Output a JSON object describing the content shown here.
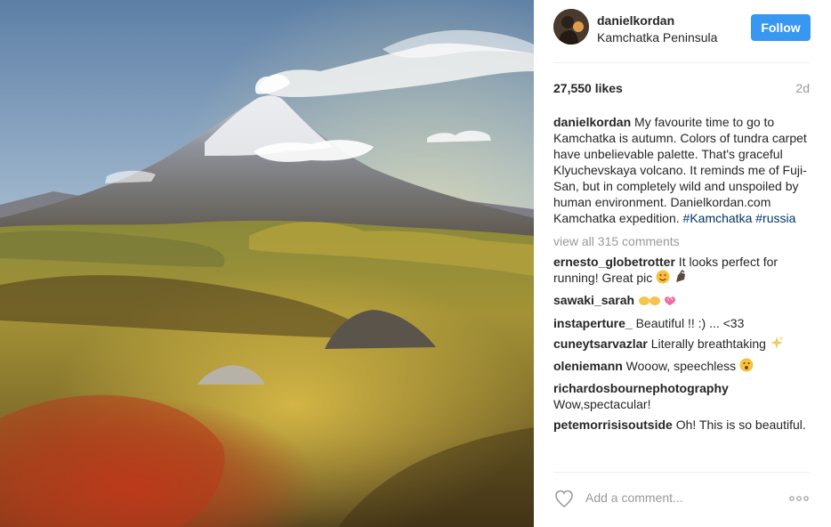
{
  "post": {
    "username": "danielkordan",
    "location": "Kamchatka Peninsula",
    "follow_label": "Follow",
    "likes": "27,550 likes",
    "time_ago": "2d",
    "caption_user": "danielkordan",
    "caption_text": " My favourite time to go to Kamchatka is autumn. Colors of tundra carpet have unbelievable palette. That's graceful Klyuchevskaya volcano. It reminds me of Fuji-San, but in completely wild and unspoiled by human environment. Danielkordan.com Kamchatka expedition. ",
    "hashtags": [
      "#Kamchatka",
      "#russia"
    ],
    "view_all": "view all 315 comments",
    "add_comment_placeholder": "Add a comment..."
  },
  "comments": [
    {
      "user": "ernesto_globetrotter",
      "text": " It looks perfect for running! Great pic ",
      "emoji": "heart-eyes-face-emoji"
    },
    {
      "user": "sawaki_sarah",
      "text": " ",
      "emoji": "clapping-hands-emoji"
    },
    {
      "user": "instaperture_",
      "text": " Beautiful !! :) ... <33",
      "emoji": ""
    },
    {
      "user": "cuneytsarvazlar",
      "text": " Literally breathtaking ",
      "emoji": "sparkles-emoji"
    },
    {
      "user": "oleniemann",
      "text": " Wooow, speechless",
      "emoji": "surprised-face-emoji"
    },
    {
      "user": "richardosbournephotography",
      "text": " Wow,spectacular!",
      "emoji": ""
    },
    {
      "user": "petemorrisisoutside",
      "text": " Oh! This is so beautiful.",
      "emoji": ""
    }
  ],
  "colors": {
    "follow_button": "#3897f0",
    "hashtag": "#003569",
    "muted_text": "#999999",
    "divider": "#efefef"
  },
  "icons": [
    "heart-icon",
    "more-options-icon"
  ]
}
